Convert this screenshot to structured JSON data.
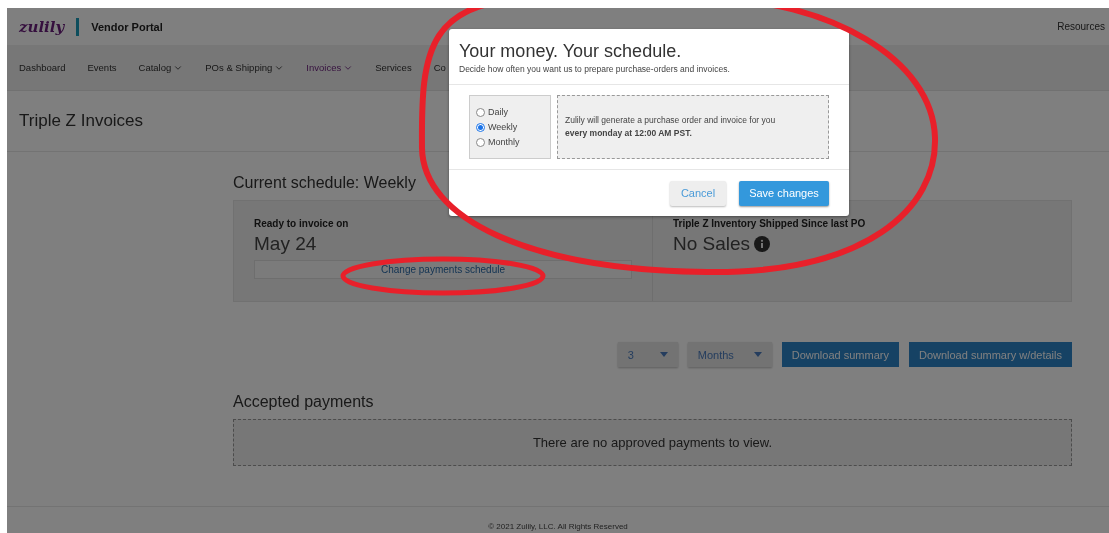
{
  "header": {
    "logo": "zulily",
    "portal": "Vendor Portal",
    "right_link": "Resources"
  },
  "nav": [
    {
      "label": "Dashboard",
      "has_menu": false,
      "selected": false
    },
    {
      "label": "Events",
      "has_menu": false,
      "selected": false
    },
    {
      "label": "Catalog",
      "has_menu": true,
      "selected": false
    },
    {
      "label": "POs & Shipping",
      "has_menu": true,
      "selected": false
    },
    {
      "label": "Invoices",
      "has_menu": true,
      "selected": true
    },
    {
      "label": "Services",
      "has_menu": false,
      "selected": false
    },
    {
      "label": "Co",
      "has_menu": false,
      "selected": false
    }
  ],
  "page_title": "Triple Z Invoices",
  "schedule": {
    "heading": "Current schedule: Weekly",
    "invoice_label": "Ready to invoice on",
    "invoice_date": "May 24",
    "change_button": "Change payments schedule",
    "inventory_label": "Triple Z Inventory Shipped Since last PO",
    "inventory_value": "No Sales"
  },
  "controls": {
    "period_count": "3",
    "period_unit": "Months",
    "buttons": [
      "Download summary",
      "Download summary w/details"
    ]
  },
  "payments": {
    "heading": "Accepted payments",
    "empty_message": "There are no approved payments to view."
  },
  "footer": "© 2021 Zulily, LLC. All Rights Reserved",
  "modal": {
    "title": "Your money. Your schedule.",
    "subtitle": "Decide how often you want us to prepare purchase-orders and invoices.",
    "options": [
      {
        "label": "Daily",
        "selected": false
      },
      {
        "label": "Weekly",
        "selected": true
      },
      {
        "label": "Monthly",
        "selected": false
      }
    ],
    "description": "Zulily will generate a purchase order and invoice for you **every monday at 12:00 AM PST.**",
    "cancel": "Cancel",
    "save": "Save changes"
  }
}
